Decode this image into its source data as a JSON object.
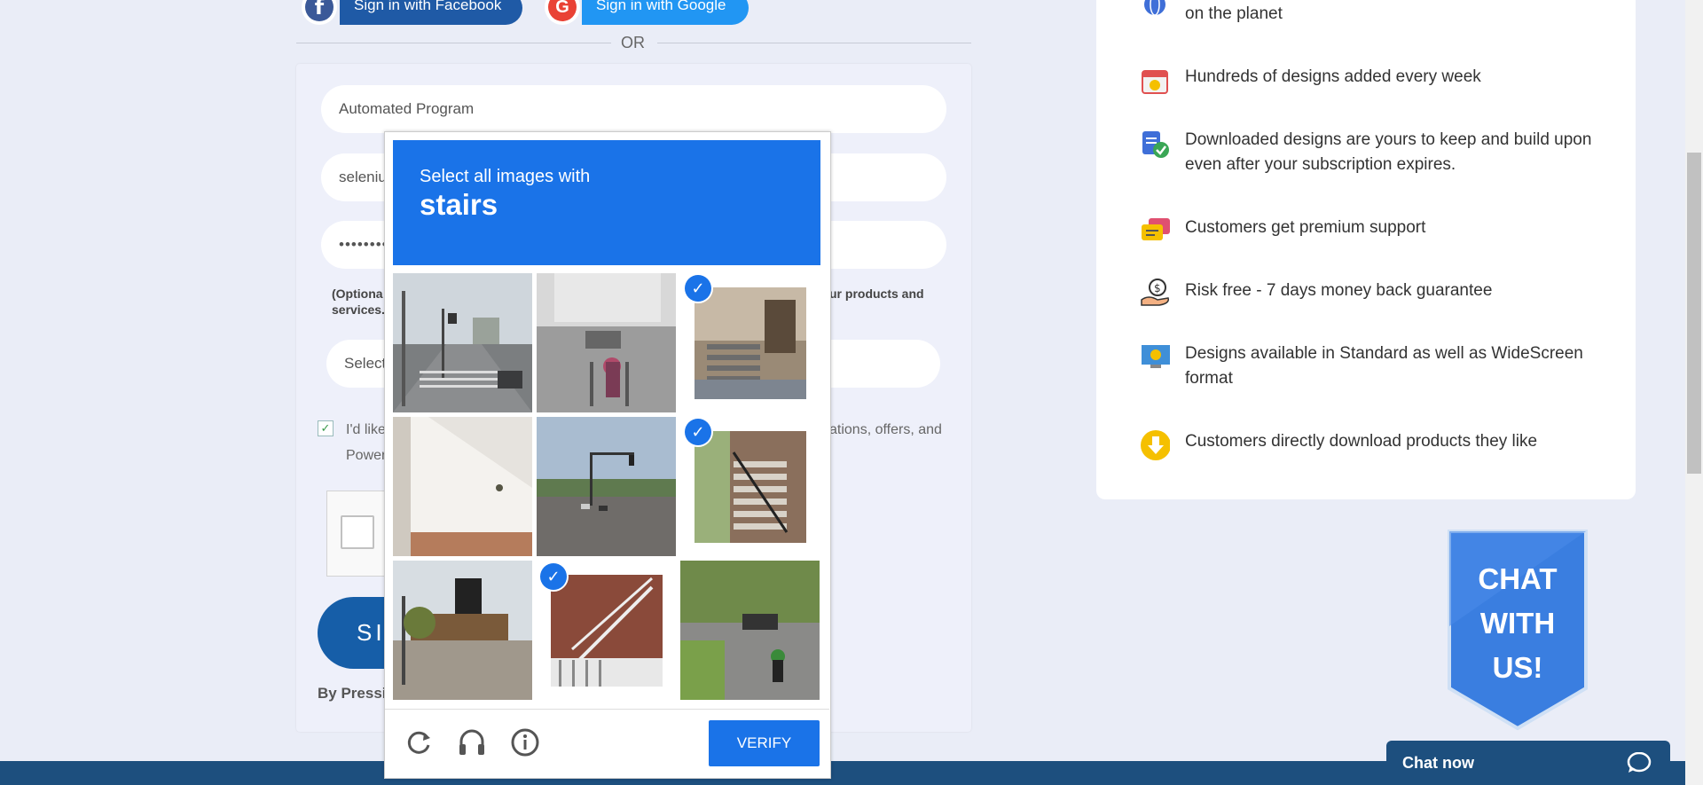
{
  "social": {
    "facebook_label": "Sign in with Facebook",
    "google_label": "Sign in with Google",
    "or_label": "OR"
  },
  "form": {
    "name_value": "Automated Program",
    "email_value": "seleniu",
    "password_value": "••••••••••",
    "note_text_left": "(Optiona",
    "note_text_left2": "services.",
    "note_text_right": "ur products and",
    "select_placeholder": "Select",
    "consent_left": "I'd like",
    "consent_left2": "Power",
    "consent_right": "ations, offers, and",
    "signup_label": "SI",
    "by_pressing": "By Pressin"
  },
  "challenge": {
    "prompt": "Select all images with",
    "target": "stairs",
    "verify_label": "VERIFY",
    "tiles": [
      {
        "id": "tile-1",
        "selected": false
      },
      {
        "id": "tile-2",
        "selected": false
      },
      {
        "id": "tile-3",
        "selected": true
      },
      {
        "id": "tile-4",
        "selected": false
      },
      {
        "id": "tile-5",
        "selected": false
      },
      {
        "id": "tile-6",
        "selected": true
      },
      {
        "id": "tile-7",
        "selected": false
      },
      {
        "id": "tile-8",
        "selected": true
      },
      {
        "id": "tile-9",
        "selected": false
      }
    ],
    "icons": [
      "refresh-icon",
      "headphones-icon",
      "info-icon"
    ]
  },
  "features": {
    "items": [
      {
        "icon": "globe-icon",
        "text": "on the planet"
      },
      {
        "icon": "calendar-icon",
        "text": "Hundreds of designs added every week"
      },
      {
        "icon": "clipboard-check-icon",
        "text": "Downloaded designs are yours to keep and build upon even after your subscription expires."
      },
      {
        "icon": "chat-bubbles-icon",
        "text": "Customers get premium support"
      },
      {
        "icon": "money-hand-icon",
        "text": "Risk free - 7 days money back guarantee"
      },
      {
        "icon": "monitor-icon",
        "text": "Designs available in Standard as well as WideScreen format"
      },
      {
        "icon": "download-icon",
        "text": "Customers directly download products they like"
      }
    ]
  },
  "chat": {
    "badge_line1": "CHAT",
    "badge_line2": "WITH",
    "badge_line3": "US!",
    "chat_now_label": "Chat now"
  },
  "colors": {
    "challenge_blue": "#1a73e8",
    "footer_navy": "#1d4f7e",
    "page_bg": "#eaedf7"
  }
}
